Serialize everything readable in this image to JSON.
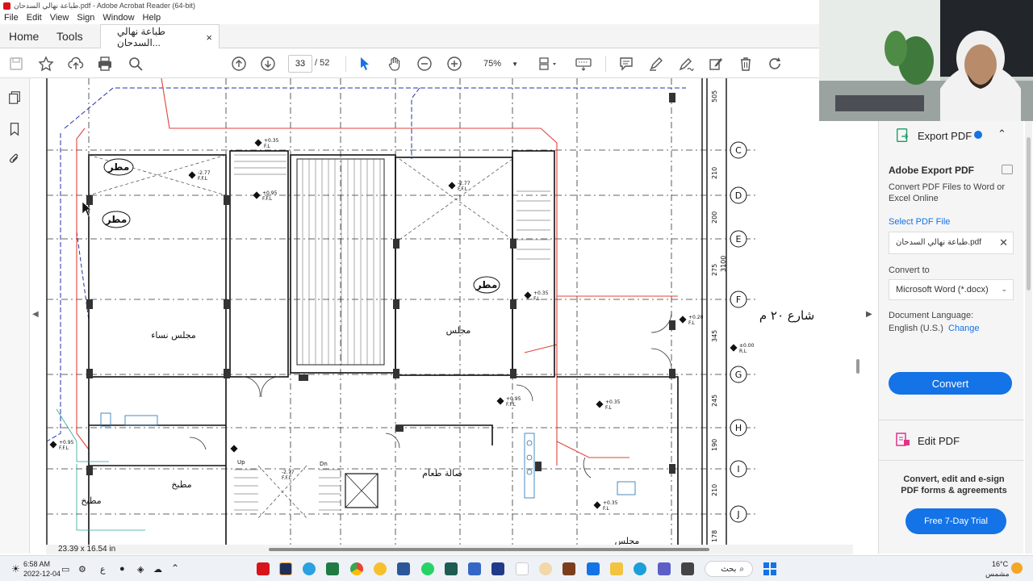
{
  "window": {
    "title": "طباعة نهالي السدحان.pdf - Adobe Acrobat Reader (64-bit)"
  },
  "menu": [
    "File",
    "Edit",
    "View",
    "Sign",
    "Window",
    "Help"
  ],
  "tabs": {
    "home": "Home",
    "tools": "Tools",
    "document": "طباعة نهالي السدحان...",
    "close": "×"
  },
  "toolbar": {
    "page_current": "33",
    "page_total": "/ 52",
    "zoom": "75%"
  },
  "drawing": {
    "rooms": [
      "مجلس نساء",
      "مجلس",
      "صالة طعام",
      "مطبخ",
      "مطبخ",
      "مجلس"
    ],
    "rain_labels": [
      "مطر",
      "مطر",
      "مطر"
    ],
    "street": "شارع ٢٠ م",
    "grid_axes": [
      "C",
      "D",
      "E",
      "F",
      "G",
      "H",
      "I",
      "J"
    ],
    "dimensions": [
      "505",
      "210",
      "200",
      "275",
      "3100",
      "345",
      "245",
      "190",
      "210",
      "178"
    ],
    "levels": [
      "+0.35",
      "-2.77",
      "+0.95",
      "-2.77",
      "+0.35",
      "+0.20",
      "±0.00",
      "+0.95",
      "+0.35",
      "+0.95",
      "-2.77",
      "+0.35"
    ],
    "level_tags": [
      "F.L",
      "F.F.L",
      "F.F.L",
      "F.F.L",
      "F.L",
      "F.L",
      "R.L",
      "F.F.L",
      "F.L",
      "F.F.L",
      "F.F.L",
      "F.L"
    ],
    "stair_labels": [
      "Up",
      "Dn"
    ]
  },
  "status": {
    "page_size": "23.39 x 16.54 in"
  },
  "right_pane": {
    "export_title": "Export PDF",
    "heading": "Adobe Export PDF",
    "description": "Convert PDF Files to Word or Excel Online",
    "select_label": "Select PDF File",
    "file_name": "طباعة نهالي السدحان.pdf",
    "convert_to_label": "Convert to",
    "format_value": "Microsoft Word (*.docx)",
    "language_label": "Document Language:",
    "language_value": "English (U.S.)",
    "change_link": "Change",
    "convert_button": "Convert",
    "edit_pdf": "Edit PDF",
    "promo_text": "Convert, edit and e-sign PDF forms & agreements",
    "trial_button": "Free 7-Day Trial"
  },
  "taskbar": {
    "time": "6:58 AM",
    "date": "2022-12-04",
    "search": "بحث",
    "weather_temp": "16°C",
    "weather_desc": "مشمس",
    "lang": "ع"
  },
  "colors": {
    "accent_blue": "#1473e6",
    "cad_red": "#e0433a",
    "cad_blue": "#2233aa",
    "grid_dash": "#333333"
  }
}
